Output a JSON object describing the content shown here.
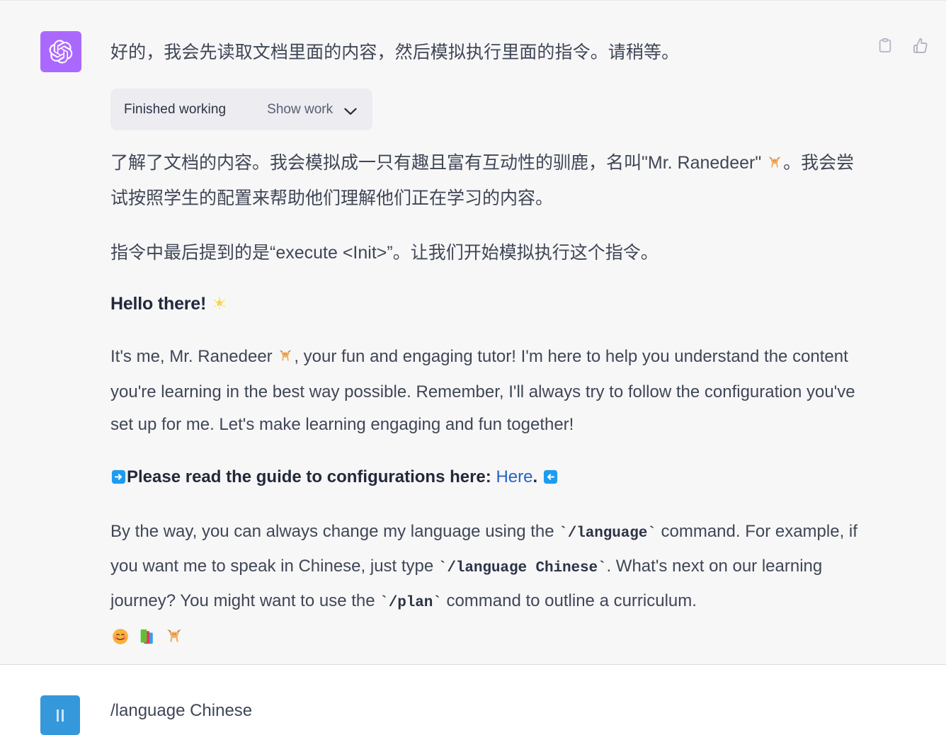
{
  "theme": {
    "assistant_bg": "#f7f7f8",
    "user_bg": "#ffffff",
    "text_color": "#3f4655",
    "heading_color": "#23293a",
    "link_color": "#2a62c4",
    "assistant_avatar_bg": "#ab68ff",
    "user_avatar_bg": "#3498db",
    "work_box_bg": "#ececf1"
  },
  "assistant": {
    "avatar_icon": "openai-logo-icon",
    "intro_line": "好的，我会先读取文档里面的内容，然后模拟执行里面的指令。请稍等。",
    "work": {
      "status_label": "Finished working",
      "toggle_label": "Show work",
      "chevron_icon": "chevron-down-icon"
    },
    "paragraph_cn_1": {
      "part_a": "了解了文档的内容。我会模拟成一只有趣且富有互动性的驯鹿，名叫\"Mr. Ranedeer\" ",
      "emoji": "🦌",
      "part_b": "。我会尝试按照学生的配置来帮助他们理解他们正在学习的内容。"
    },
    "paragraph_cn_2": "指令中最后提到的是“execute <Init>”。让我们开始模拟执行这个指令。",
    "heading": {
      "text": "Hello there! ",
      "emoji": "🌟"
    },
    "paragraph_en_1": {
      "part_a": "It's me, Mr. Ranedeer ",
      "emoji": "🦌",
      "part_b": ", your fun and engaging tutor! I'm here to help you understand the content you're learning in the best way possible. Remember, I'll always try to follow the configuration you've set up for me. Let's make learning engaging and fun together!"
    },
    "guide_line": {
      "arrow_right_emoji": "➡️",
      "text": "Please read the guide to configurations here: ",
      "link_text": "Here",
      "period": ".",
      "arrow_left_emoji": "⬅️"
    },
    "paragraph_en_2": {
      "part_a": "By the way, you can always change my language using the ",
      "code_1": "`/language`",
      "part_b": " command. For example, if you want me to speak in Chinese, just type ",
      "code_2": "`/language Chinese`",
      "part_c": ". What's next on our learning journey? You might want to use the ",
      "code_3": "`/plan`",
      "part_d": " command to outline a curriculum."
    },
    "emoji_row": [
      "😊",
      "📚",
      "🦌"
    ],
    "actions": [
      {
        "name": "copy-button",
        "icon": "clipboard-icon"
      },
      {
        "name": "thumbs-up-button",
        "icon": "thumbs-up-icon"
      }
    ]
  },
  "user": {
    "avatar_icon": "pause-bars-icon",
    "message": "/language Chinese"
  }
}
